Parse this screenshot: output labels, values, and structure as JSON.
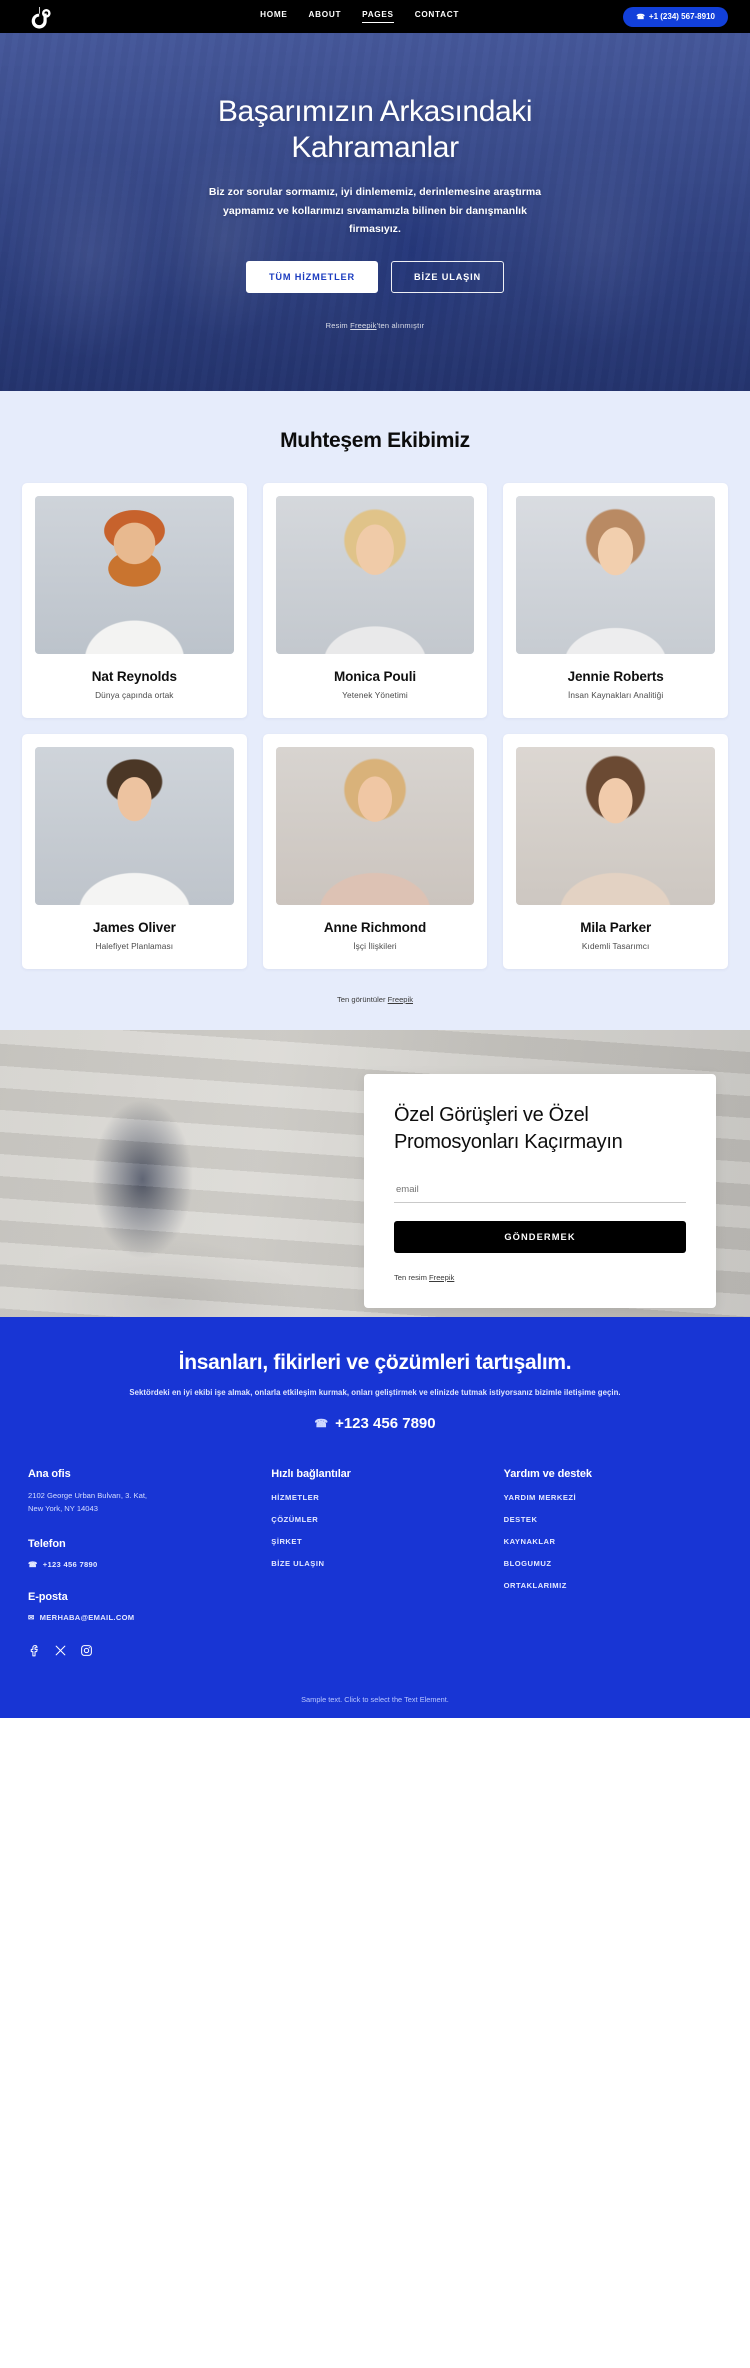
{
  "nav": {
    "logo_name": "logo-mark",
    "links": [
      {
        "label": "HOME",
        "active": false
      },
      {
        "label": "ABOUT",
        "active": false
      },
      {
        "label": "PAGES",
        "active": true
      },
      {
        "label": "CONTACT",
        "active": false
      }
    ],
    "phone_label": "+1 (234) 567-8910",
    "phone_icon": "phone-icon",
    "accent": "#1240da",
    "bar_bg": "#000000"
  },
  "hero": {
    "title_line1": "Başarımızın Arkasındaki",
    "title_line2": "Kahramanlar",
    "subtitle": "Biz zor sorular sormamız, iyi dinlememiz, derinlemesine araştırma yapmamız ve kollarımızı sıvamamızla bilinen bir danışmanlık firmasıyız.",
    "primary_button": "TÜM HİZMETLER",
    "secondary_button": "BİZE ULAŞIN",
    "credit_prefix": "Resim ",
    "credit_link": "Freepik",
    "credit_suffix": "'ten alınmıştır",
    "overlay_color": "#1e3896"
  },
  "team": {
    "heading": "Muhteşem Ekibimiz",
    "members": [
      {
        "name": "Nat Reynolds",
        "role": "Dünya çapında ortak"
      },
      {
        "name": "Monica Pouli",
        "role": "Yetenek Yönetimi"
      },
      {
        "name": "Jennie Roberts",
        "role": "İnsan Kaynakları Analitiği"
      },
      {
        "name": "James Oliver",
        "role": "Halefiyet Planlaması"
      },
      {
        "name": "Anne Richmond",
        "role": "İşçi İlişkileri"
      },
      {
        "name": "Mila Parker",
        "role": "Kıdemli Tasarımcı"
      }
    ],
    "credit_prefix": "Ten görüntüler ",
    "credit_link": "Freepik",
    "bg": "#e6ecfb"
  },
  "subscribe": {
    "title": "Özel Görüşleri ve Özel Promosyonları Kaçırmayın",
    "email_placeholder": "email",
    "email_value": "",
    "button_label": "GÖNDERMEK",
    "credit_prefix": "Ten resim ",
    "credit_link": "Freepik"
  },
  "cta": {
    "title": "İnsanları, fikirleri ve çözümleri tartışalım.",
    "subtitle": "Sektördeki en iyi ekibi işe almak, onlarla etkileşim kurmak, onları geliştirmek ve elinizde tutmak istiyorsanız bizimle iletişime geçin.",
    "phone": "+123 456 7890",
    "phone_icon": "phone-icon",
    "bg": "#1835d4"
  },
  "footer": {
    "office_heading": "Ana ofis",
    "office_address": "2102 George Urban Bulvarı, 3. Kat,\nNew York, NY 14043",
    "phone_heading": "Telefon",
    "phone_value": "+123 456 7890",
    "phone_icon": "phone-icon",
    "email_heading": "E-posta",
    "email_value": "MERHABA@EMAIL.COM",
    "email_icon": "mail-icon",
    "quick_links_heading": "Hızlı bağlantılar",
    "quick_links": [
      "HİZMETLER",
      "ÇÖZÜMLER",
      "ŞİRKET",
      "BİZE ULAŞIN"
    ],
    "help_heading": "Yardım ve destek",
    "help_links": [
      "YARDIM MERKEZİ",
      "DESTEK",
      "KAYNAKLAR",
      "BLOGUMUZ",
      "ORTAKLARIMIZ"
    ],
    "social": [
      "facebook-icon",
      "x-icon",
      "instagram-icon"
    ],
    "bottom_note": "Sample text. Click to select the Text Element."
  }
}
